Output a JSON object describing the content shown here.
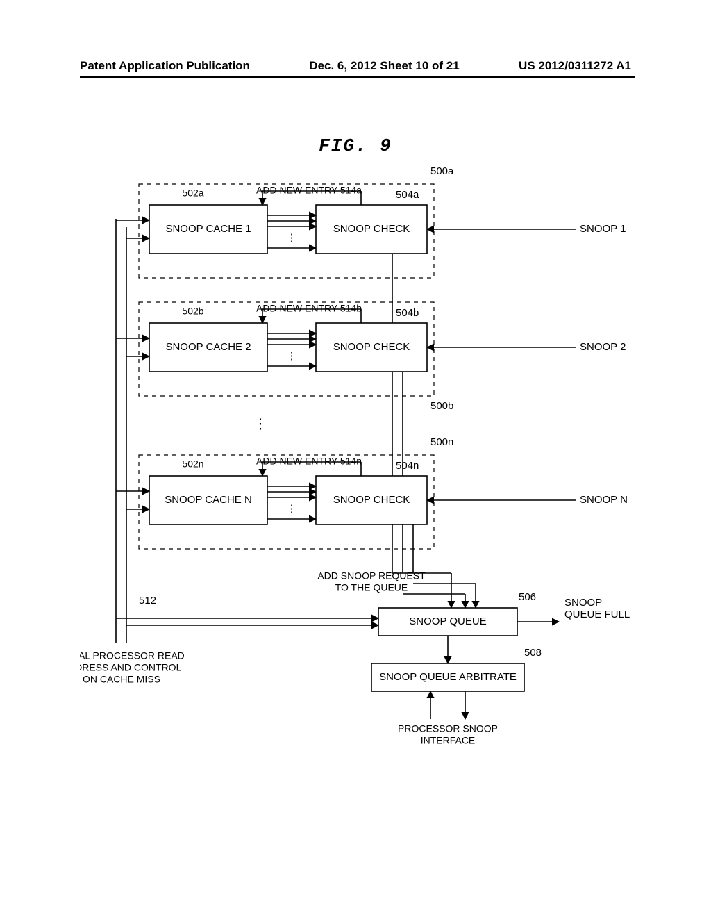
{
  "header": {
    "left": "Patent Application Publication",
    "center": "Dec. 6, 2012  Sheet 10 of 21",
    "right": "US 2012/0311272 A1"
  },
  "figure_title": "FIG. 9",
  "units": [
    {
      "ref_group": "500a",
      "cache_ref": "502a",
      "check_ref": "504a",
      "add_entry": "ADD NEW ENTRY 514a",
      "cache_label": "SNOOP CACHE 1",
      "check_label": "SNOOP CHECK",
      "snoop_label": "SNOOP 1"
    },
    {
      "ref_group": "500b",
      "cache_ref": "502b",
      "check_ref": "504b",
      "add_entry": "ADD NEW ENTRY 514b",
      "cache_label": "SNOOP CACHE 2",
      "check_label": "SNOOP CHECK",
      "snoop_label": "SNOOP 2"
    },
    {
      "ref_group": "500n",
      "cache_ref": "502n",
      "check_ref": "504n",
      "add_entry": "ADD NEW ENTRY 514n",
      "cache_label": "SNOOP CACHE N",
      "check_label": "SNOOP CHECK",
      "snoop_label": "SNOOP N"
    }
  ],
  "add_snoop_request": [
    "ADD SNOOP REQUEST",
    "TO THE QUEUE"
  ],
  "queue": {
    "label": "SNOOP QUEUE",
    "ref": "506",
    "full": [
      "SNOOP",
      "QUEUE FULL"
    ]
  },
  "arbitrate": {
    "label": "SNOOP QUEUE ARBITRATE",
    "ref": "508"
  },
  "interface": [
    "PROCESSOR SNOOP",
    "INTERFACE"
  ],
  "local_read": {
    "ref": "512",
    "lines": [
      "LOCAL PROCESSOR READ",
      "ADDRESS AND CONTROL",
      "ON CACHE MISS"
    ]
  }
}
